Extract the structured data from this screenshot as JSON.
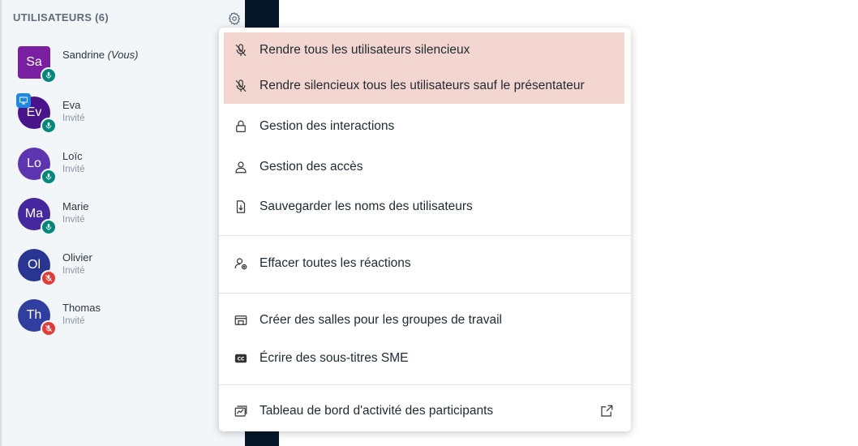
{
  "sidebar": {
    "header": "UTILISATEURS (6)",
    "users": [
      {
        "initials": "Sa",
        "name": "Sandrine",
        "suffix": "(Vous)",
        "role": "",
        "color": "#7b1fa2",
        "mic": "on",
        "presenter": false
      },
      {
        "initials": "Ev",
        "name": "Eva",
        "suffix": "",
        "role": "Invité",
        "color": "#4a148c",
        "mic": "on",
        "presenter": true
      },
      {
        "initials": "Lo",
        "name": "Loïc",
        "suffix": "",
        "role": "Invité",
        "color": "#5e35b1",
        "mic": "on",
        "presenter": false
      },
      {
        "initials": "Ma",
        "name": "Marie",
        "suffix": "",
        "role": "Invité",
        "color": "#4527a0",
        "mic": "on",
        "presenter": false
      },
      {
        "initials": "Ol",
        "name": "Olivier",
        "suffix": "",
        "role": "Invité",
        "color": "#283593",
        "mic": "off",
        "presenter": false
      },
      {
        "initials": "Th",
        "name": "Thomas",
        "suffix": "",
        "role": "Invité",
        "color": "#303f9f",
        "mic": "off",
        "presenter": false
      }
    ]
  },
  "menu": {
    "items": [
      {
        "label": "Rendre tous les utilisateurs silencieux",
        "icon": "mic-off-icon"
      },
      {
        "label": "Rendre silencieux tous les utilisateurs sauf le présentateur",
        "icon": "mic-off-icon"
      },
      {
        "label": "Gestion des interactions",
        "icon": "lock-icon"
      },
      {
        "label": "Gestion des accès",
        "icon": "user-icon"
      },
      {
        "label": "Sauvegarder les noms des utilisateurs",
        "icon": "download-file-icon"
      },
      {
        "label": "Effacer toutes les réactions",
        "icon": "clear-reactions-icon"
      },
      {
        "label": "Créer des salles pour les groupes de travail",
        "icon": "rooms-icon"
      },
      {
        "label": "Écrire des sous-titres SME",
        "icon": "closed-captions-icon"
      },
      {
        "label": "Tableau de bord d'activité des participants",
        "icon": "dashboard-icon"
      }
    ]
  },
  "colors": {
    "highlight": "#f3d6cf",
    "mic_on": "#00897b",
    "mic_off": "#e53935",
    "presenter": "#1e88e5",
    "dark_strip": "#06172a"
  }
}
